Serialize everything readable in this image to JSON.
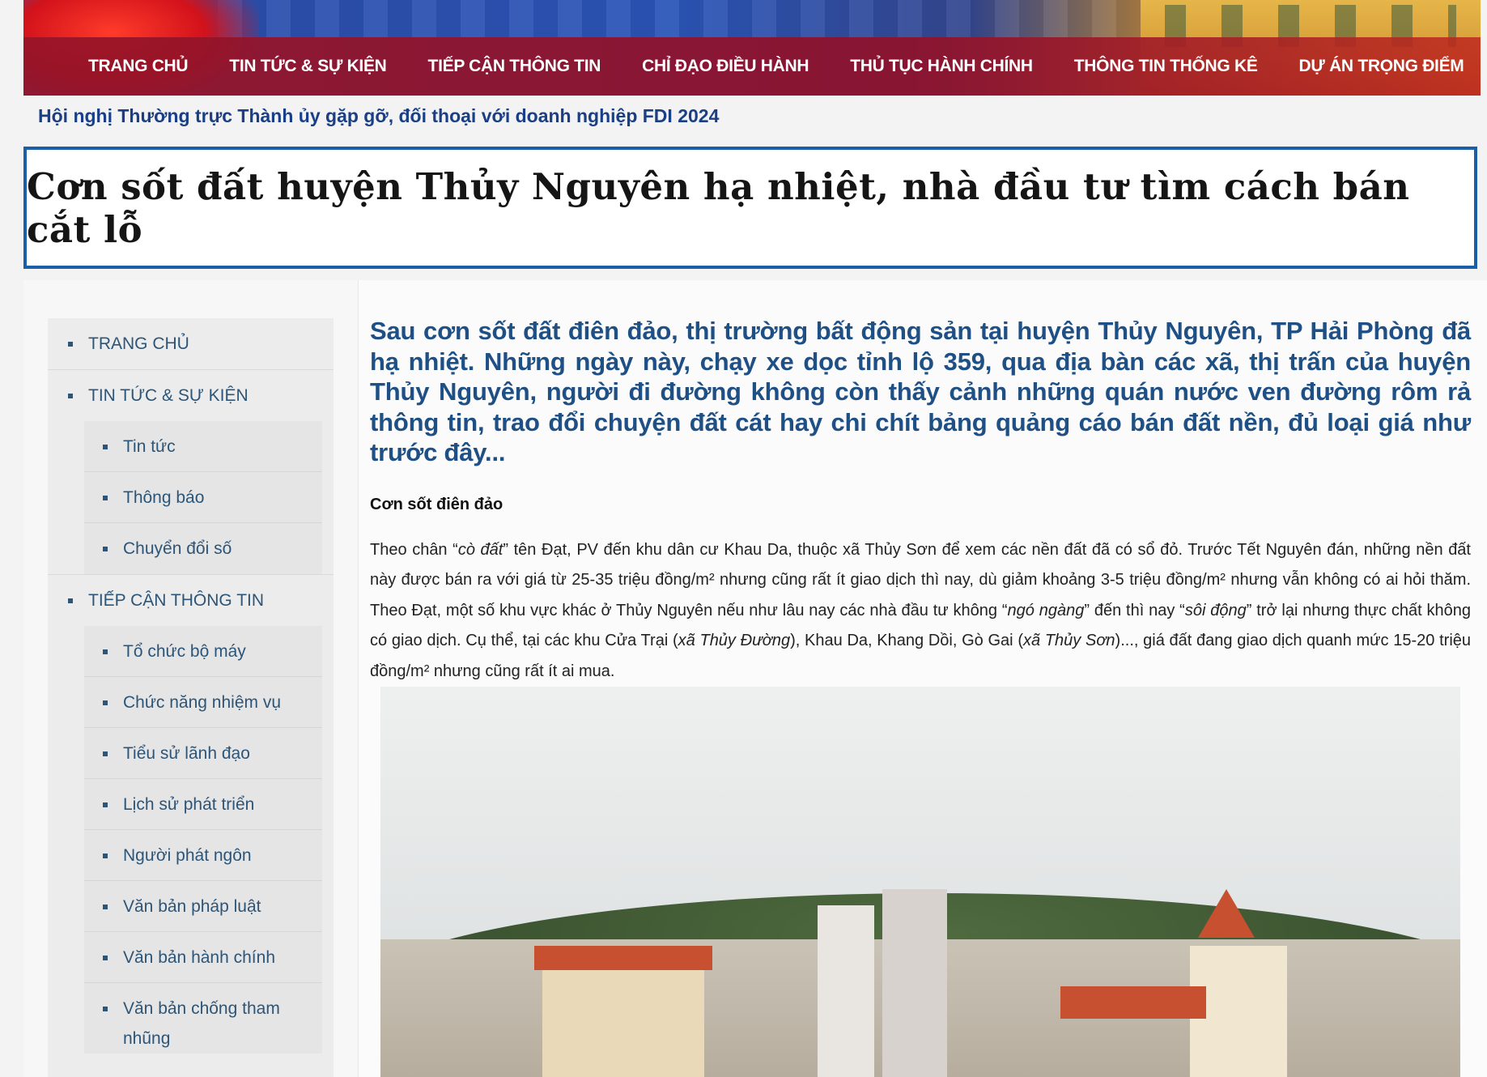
{
  "nav": {
    "items": [
      "TRANG CHỦ",
      "TIN TỨC & SỰ KIỆN",
      "TIẾP CẬN THÔNG TIN",
      "CHỈ ĐẠO ĐIỀU HÀNH",
      "THỦ TỤC HÀNH CHÍNH",
      "THÔNG TIN THỐNG KÊ",
      "DỰ ÁN TRỌNG ĐIỂM"
    ]
  },
  "ticker": "Hội nghị Thường trực Thành ủy gặp gỡ, đối thoại với doanh nghiệp FDI 2024",
  "article": {
    "title": "Cơn sốt đất huyện Thủy Nguyên hạ nhiệt, nhà đầu tư tìm cách bán cắt lỗ",
    "lead": "Sau cơn sốt đất điên đảo, thị trường bất động sản tại huyện Thủy Nguyên, TP Hải Phòng đã hạ nhiệt. Những ngày này, chạy xe dọc tỉnh lộ 359, qua địa bàn các xã, thị trấn của huyện Thủy Nguyên, người đi đường không còn thấy cảnh những quán nước ven đường rôm rả thông tin, trao đổi chuyện đất cát hay chi chít bảng quảng cáo bán đất nền, đủ loại giá như trước đây...",
    "subhead": "Cơn sốt điên đảo",
    "para": {
      "t1": "Theo chân “",
      "i1": "cò đất",
      "t2": "” tên Đạt, PV đến khu dân cư Khau Da, thuộc xã Thủy Sơn để xem các nền đất đã có sổ đỏ. Trước Tết Nguyên đán, những nền đất này được bán ra với giá từ 25-35 triệu đồng/m² nhưng cũng rất ít giao dịch thì nay, dù giảm khoảng 3-5 triệu đồng/m² nhưng vẫn không có ai hỏi thăm. Theo Đạt, một số khu vực khác ở Thủy Nguyên nếu như lâu nay các nhà đầu tư không “",
      "i2": "ngó ngàng",
      "t3": "” đến thì nay “",
      "i3": "sôi động",
      "t4": "” trở lại nhưng thực chất không có giao dịch. Cụ thể, tại các khu Cửa Trại (",
      "i4": "xã Thủy Đường",
      "t5": "), Khau Da, Khang Dồi, Gò Gai (",
      "i5": "xã Thủy Sơn",
      "t6": ")..., giá đất đang giao dịch quanh mức 15-20 triệu đồng/m² nhưng cũng rất ít ai mua."
    }
  },
  "sidebar": {
    "home": "TRANG CHỦ",
    "news": "TIN TỨC & SỰ KIỆN",
    "news_sub": [
      "Tin tức",
      "Thông báo",
      "Chuyển đổi số"
    ],
    "access": "TIẾP CẬN THÔNG TIN",
    "access_sub": [
      "Tổ chức bộ máy",
      "Chức năng nhiệm vụ",
      "Tiểu sử lãnh đạo",
      "Lịch sử phát triển",
      "Người phát ngôn",
      "Văn bản pháp luật",
      "Văn bản hành chính",
      "Văn bản chống tham nhũng"
    ]
  }
}
